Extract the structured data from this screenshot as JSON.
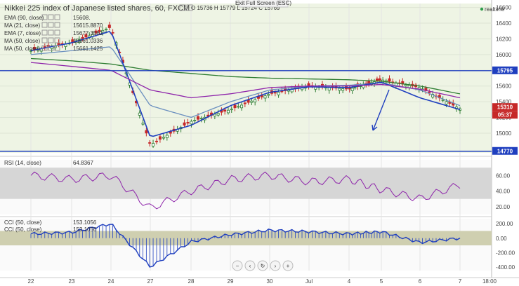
{
  "header": {
    "title": "Nikkei 225 index of Japanese listed shares, 60, FXCM",
    "ohlc": {
      "o_label": "O",
      "o": "15736",
      "h_label": "H",
      "h": "15779",
      "l_label": "L",
      "l": "15724",
      "c_label": "C",
      "c": "15769"
    },
    "exit_fullscreen": "Exit Full Screen (ESC)",
    "realtime": "realtime"
  },
  "legend": [
    {
      "label": "EMA (90, close)",
      "value": "15608.",
      "color": "#2e7d32"
    },
    {
      "label": "MA (21, close)",
      "value": "15615.8870",
      "color": "#1f3fbf"
    },
    {
      "label": "EMA (7, close)",
      "value": "15677.3562",
      "color": "#1f3fbf"
    },
    {
      "label": "MA (50, close)",
      "value": "15661.0336",
      "color": "#8e24aa"
    },
    {
      "label": "MA (50, close)",
      "value": "15661.1425",
      "color": "#8e24aa"
    }
  ],
  "colors": {
    "up": "#2e7d32",
    "down": "#c62828",
    "ema90": "#2e7d32",
    "ma21": "#6a8fbf",
    "ema7": "#1f3fbf",
    "ma50": "#8e24aa",
    "hline": "#1f3fbf",
    "rsi": "#8e24aa",
    "cci": "#1f3fbf",
    "band": "#d6d6d6",
    "cciband": "#cfcfb0",
    "bg": "#eef4e4"
  },
  "price_tags": [
    {
      "value": "15795",
      "color": "#1f3fbf"
    },
    {
      "value": "15310",
      "color": "#c62828"
    },
    {
      "value": "05:37",
      "color": "#c62828"
    },
    {
      "value": "14770",
      "color": "#1f3fbf"
    }
  ],
  "rsi": {
    "label": "RSI (14, close)",
    "value": "64.8367"
  },
  "cci": [
    {
      "label": "CCI (50, close)",
      "value": "153.1056"
    },
    {
      "label": "CCI (50, close)",
      "value": "153.1056"
    }
  ],
  "controls": [
    "−",
    "‹",
    "↻",
    "›",
    "+"
  ],
  "chart_data": [
    {
      "type": "line",
      "title": "Nikkei 225 index of Japanese listed shares, 60, FXCM",
      "x": [
        "22",
        "23",
        "24",
        "27",
        "28",
        "29",
        "30",
        "Jul",
        "4",
        "5",
        "6",
        "7"
      ],
      "ylim": [
        14750,
        16650
      ],
      "y_ticks": [
        15000,
        15200,
        15400,
        15600,
        15800,
        16000,
        16200,
        16400,
        16600
      ],
      "x_labels": [
        "22",
        "23",
        "24",
        "27",
        "28",
        "29",
        "30",
        "Jul",
        "4",
        "5",
        "6",
        "7",
        "18:00"
      ],
      "series": [
        {
          "name": "Price (hourly close)",
          "values": [
            16050,
            16150,
            16350,
            14850,
            15150,
            15300,
            15500,
            15600,
            15560,
            15680,
            15580,
            15310
          ]
        },
        {
          "name": "EMA (90, close)",
          "values": [
            15950,
            15920,
            15880,
            15800,
            15760,
            15720,
            15700,
            15690,
            15680,
            15660,
            15600,
            15500
          ]
        },
        {
          "name": "MA (21, close)",
          "values": [
            16000,
            16050,
            16100,
            15350,
            15200,
            15400,
            15550,
            15600,
            15610,
            15640,
            15550,
            15350
          ]
        },
        {
          "name": "EMA (7, close)",
          "values": [
            16050,
            16150,
            16300,
            14950,
            15100,
            15350,
            15520,
            15590,
            15580,
            15650,
            15450,
            15300
          ]
        },
        {
          "name": "MA (50, close)",
          "values": [
            15900,
            15850,
            15800,
            15550,
            15450,
            15500,
            15580,
            15600,
            15600,
            15620,
            15560,
            15450
          ]
        }
      ],
      "horizontal_levels": [
        15795,
        14770
      ],
      "annotation": "down arrow"
    },
    {
      "type": "line",
      "title": "RSI (14, close)",
      "ylim": [
        10,
        80
      ],
      "y_ticks": [
        20,
        40,
        60
      ],
      "band": [
        30,
        70
      ],
      "series": [
        {
          "name": "RSI (14, close)",
          "values": [
            60,
            55,
            60,
            18,
            40,
            55,
            60,
            52,
            55,
            42,
            30,
            48
          ]
        }
      ]
    },
    {
      "type": "bar",
      "title": "CCI (50, close)",
      "ylim": [
        -450,
        270
      ],
      "y_ticks": [
        -400,
        -200,
        0,
        200
      ],
      "band": [
        -100,
        100
      ],
      "series": [
        {
          "name": "CCI (50, close)",
          "values": [
            60,
            80,
            200,
            -400,
            -50,
            50,
            110,
            90,
            60,
            90,
            -60,
            0
          ]
        }
      ]
    }
  ]
}
